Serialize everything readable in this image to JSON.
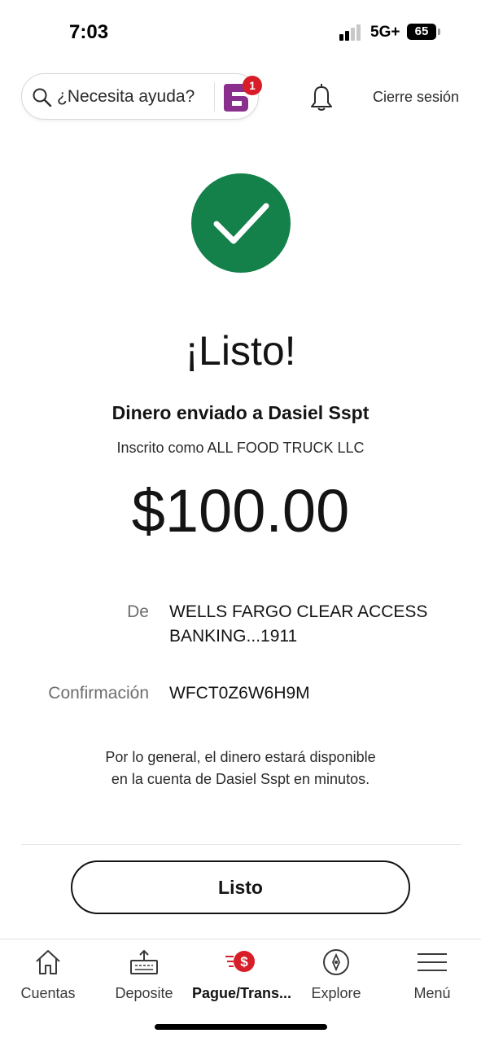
{
  "status_bar": {
    "time": "7:03",
    "network": "5G+",
    "battery": "65"
  },
  "header": {
    "help_label": "¿Necesita ayuda?",
    "assistant_badge_count": "1",
    "signout_label": "Cierre sesión"
  },
  "confirmation": {
    "title": "¡Listo!",
    "recipient_line": "Dinero enviado a Dasiel Sspt",
    "enrolled_line": "Inscrito como ALL FOOD TRUCK LLC",
    "amount": "$100.00",
    "from_label": "De",
    "from_value": "WELLS FARGO CLEAR ACCESS BANKING...1911",
    "confirmation_label": "Confirmación",
    "confirmation_value": "WFCT0Z6W6H9M",
    "availability_line1": "Por lo general, el dinero estará disponible",
    "availability_line2": "en la cuenta de Dasiel Sspt en minutos.",
    "done_button": "Listo"
  },
  "bottom_nav": {
    "items": [
      {
        "label": "Cuentas",
        "icon": "home-icon"
      },
      {
        "label": "Deposite",
        "icon": "deposit-icon"
      },
      {
        "label": "Pague/Trans...",
        "icon": "pay-transfer-icon",
        "active": true
      },
      {
        "label": "Explore",
        "icon": "compass-icon"
      },
      {
        "label": "Menú",
        "icon": "hamburger-menu-icon"
      }
    ]
  },
  "colors": {
    "success_green": "#14804a",
    "brand_red": "#d71e28",
    "assistant_purple": "#8b2f8f"
  }
}
